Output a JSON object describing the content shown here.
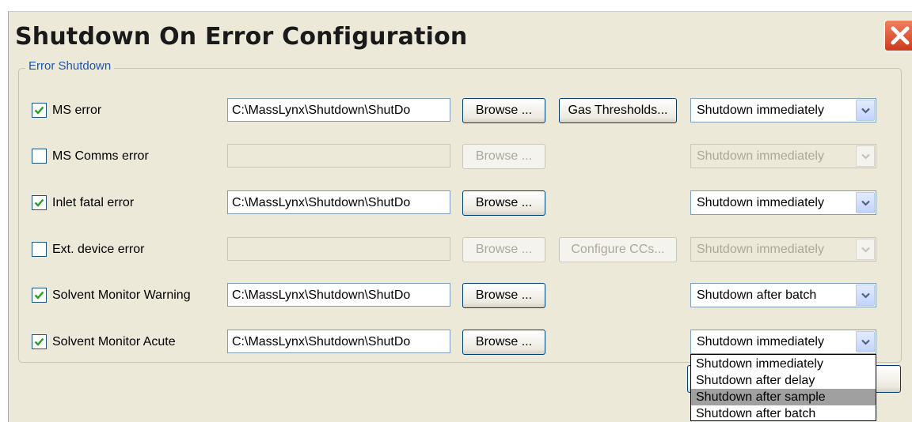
{
  "window": {
    "title": "Shutdown On Error Configuration"
  },
  "group": {
    "legend": "Error Shutdown"
  },
  "rows": [
    {
      "label": "MS error",
      "checked": true,
      "path": "C:\\MassLynx\\Shutdown\\ShutDo",
      "browse": "Browse ...",
      "extra_button": "Gas Thresholds...",
      "action": "Shutdown immediately"
    },
    {
      "label": "MS Comms error",
      "checked": false,
      "path": "",
      "browse": "Browse ...",
      "extra_button": "",
      "action": "Shutdown immediately"
    },
    {
      "label": "Inlet fatal error",
      "checked": true,
      "path": "C:\\MassLynx\\Shutdown\\ShutDo",
      "browse": "Browse ...",
      "extra_button": "",
      "action": "Shutdown immediately"
    },
    {
      "label": "Ext. device error",
      "checked": false,
      "path": "",
      "browse": "Browse ...",
      "extra_button": "Configure CCs...",
      "action": "Shutdown immediately"
    },
    {
      "label": "Solvent Monitor Warning",
      "checked": true,
      "path": "C:\\MassLynx\\Shutdown\\ShutDo",
      "browse": "Browse ...",
      "extra_button": "",
      "action": "Shutdown after batch"
    },
    {
      "label": "Solvent Monitor Acute",
      "checked": true,
      "path": "C:\\MassLynx\\Shutdown\\ShutDo",
      "browse": "Browse ...",
      "extra_button": "",
      "action": "Shutdown immediately"
    }
  ],
  "dropdown": {
    "options": [
      "Shutdown immediately",
      "Shutdown after delay",
      "Shutdown after sample",
      "Shutdown after batch"
    ],
    "highlighted": "Shutdown after sample"
  },
  "colors": {
    "legend": "#1e54b0",
    "dialog_bg": "#ece9d8",
    "close_button": "#d9482a",
    "highlight": "#a0a0a0"
  },
  "icons": {
    "close": "close-icon",
    "check": "check-icon",
    "dropdown": "chevron-down-icon"
  }
}
